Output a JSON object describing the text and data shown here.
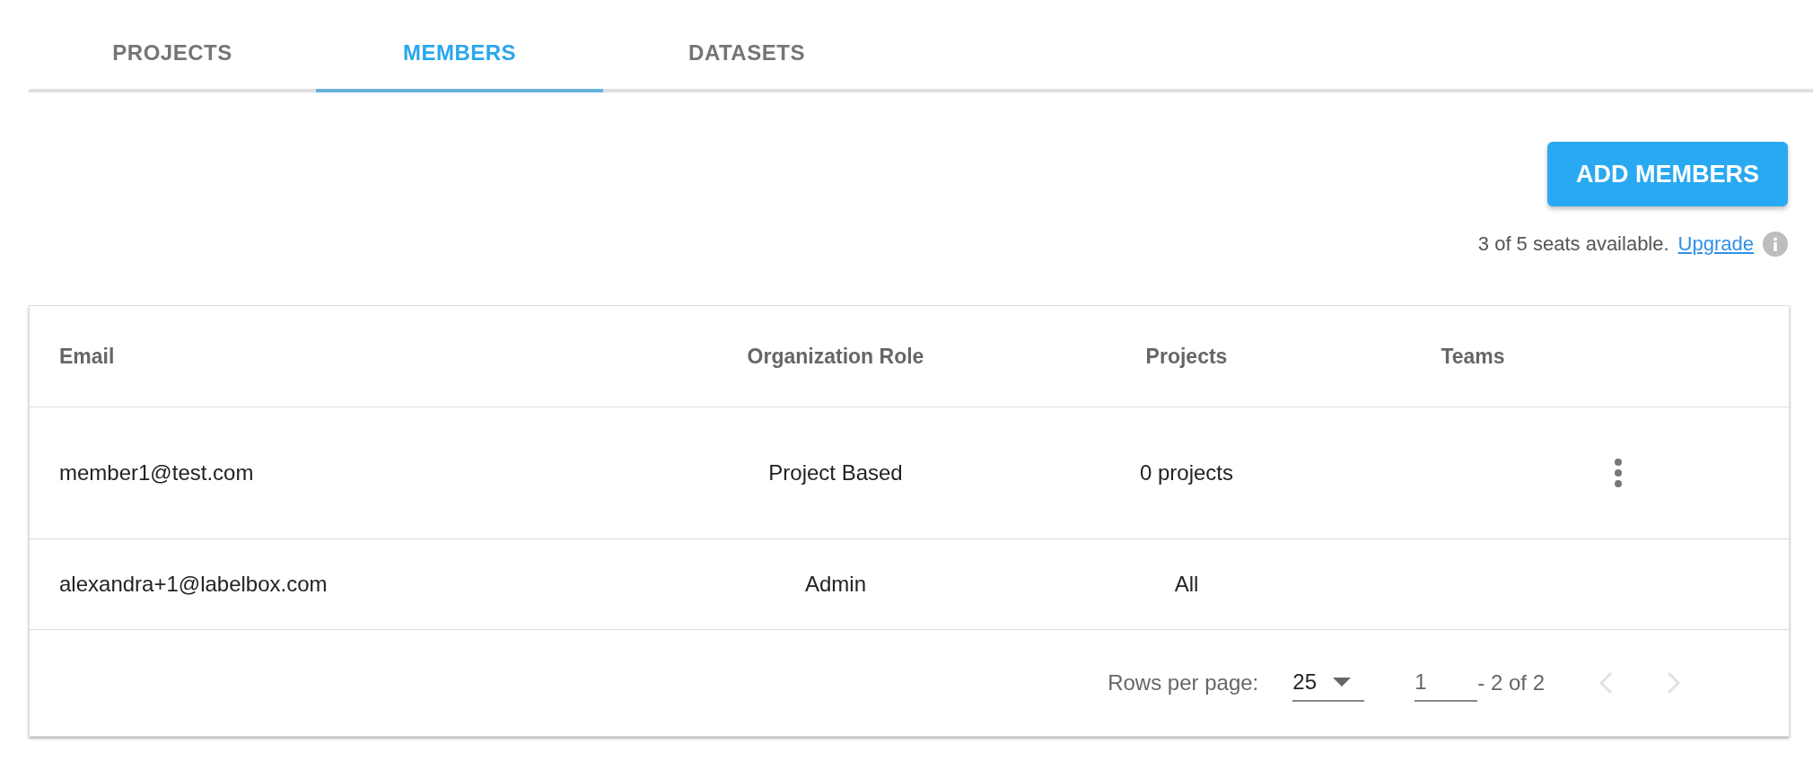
{
  "tabs": [
    {
      "label": "PROJECTS",
      "selected": false
    },
    {
      "label": "MEMBERS",
      "selected": true
    },
    {
      "label": "DATASETS",
      "selected": false
    }
  ],
  "add_button": "ADD MEMBERS",
  "seats": {
    "text": "3 of 5 seats available.",
    "link": "Upgrade"
  },
  "table": {
    "columns": [
      "Email",
      "Organization Role",
      "Projects",
      "Teams"
    ],
    "rows": [
      {
        "email": "member1@test.com",
        "role": "Project Based",
        "projects": "0 projects",
        "teams": "",
        "menu": true
      },
      {
        "email": "alexandra+1@labelbox.com",
        "role": "Admin",
        "projects": "All",
        "teams": "",
        "menu": false
      }
    ]
  },
  "pagination": {
    "rows_label": "Rows per page:",
    "rows_value": "25",
    "page": "1",
    "range": "- 2 of 2",
    "prev_disabled": true,
    "next_disabled": true
  }
}
